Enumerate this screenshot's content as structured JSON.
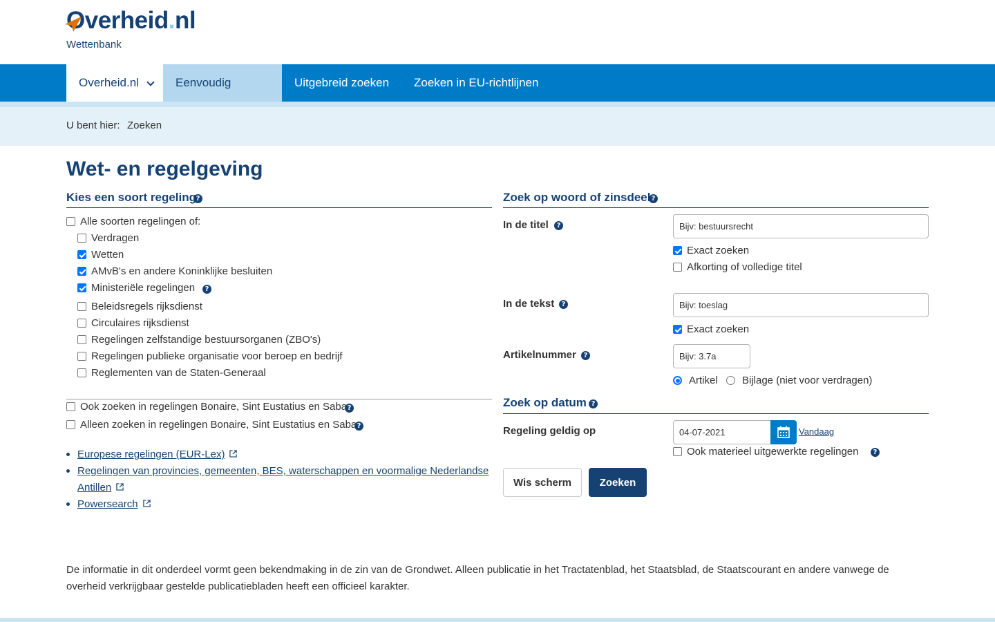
{
  "header": {
    "logo_text": "Overheid",
    "logo_dot": ".",
    "logo_tld": "nl",
    "subtitle": "Wettenbank"
  },
  "nav": {
    "items": [
      "Overheid.nl",
      "Eenvoudig zoeken",
      "Uitgebreid zoeken",
      "Zoeken in EU-richtlijnen"
    ],
    "active": "Eenvoudig zoeken"
  },
  "breadcrumb": {
    "label": "U bent hier:",
    "current": "Zoeken"
  },
  "page_title": "Wet- en regelgeving",
  "left": {
    "section_title": "Kies een soort regeling",
    "all_types": {
      "label": "Alle soorten regelingen of:",
      "checked": false
    },
    "types": [
      {
        "label": "Verdragen",
        "checked": false
      },
      {
        "label": "Wetten",
        "checked": true
      },
      {
        "label": "AMvB's en andere Koninklijke besluiten",
        "checked": true
      },
      {
        "label": "Ministeriële regelingen",
        "checked": true
      },
      {
        "label": "Beleidsregels rijksdienst",
        "checked": false
      },
      {
        "label": "Circulaires rijksdienst",
        "checked": false
      },
      {
        "label": "Regelingen zelfstandige bestuursorganen (ZBO's)",
        "checked": false
      },
      {
        "label": "Regelingen publieke organisatie voor beroep en bedrijf",
        "checked": false
      },
      {
        "label": "Reglementen van de Staten-Generaal",
        "checked": false
      }
    ],
    "bes_also": {
      "label": "Ook zoeken in regelingen Bonaire, Sint Eustatius en Saba",
      "checked": false
    },
    "bes_only": {
      "label": "Alleen zoeken in regelingen Bonaire, Sint Eustatius en Saba",
      "checked": false
    },
    "links": [
      "Europese regelingen (EUR-Lex)",
      "Regelingen van provincies, gemeenten, BES, waterschappen en voormalige Nederlandse",
      "Antillen",
      "Powersearch"
    ]
  },
  "right": {
    "word_section_title": "Zoek op woord of zinsdeel",
    "title_label": "In de titel",
    "title_placeholder": "Bijv: bestuursrecht",
    "title_exact": {
      "label": "Exact zoeken",
      "checked": true
    },
    "title_abbrev": {
      "label": "Afkorting of volledige titel",
      "checked": false
    },
    "text_label": "In de tekst",
    "text_placeholder": "Bijv: toeslag",
    "text_exact": {
      "label": "Exact zoeken",
      "checked": true
    },
    "article_label": "Artikelnummer",
    "article_placeholder": "Bijv: 3.7a",
    "article_radio": [
      {
        "label": "Artikel",
        "checked": true
      },
      {
        "label": "Bijlage (niet voor verdragen)",
        "checked": false
      }
    ],
    "date_section_title": "Zoek op datum",
    "valid_on_label": "Regeling geldig op",
    "date_value": "04-07-2021",
    "today_link": "Vandaag",
    "material": {
      "label": "Ook materieel uitgewerkte regelingen",
      "checked": false
    },
    "clear_button": "Wis scherm",
    "search_button": "Zoeken"
  },
  "disclaimer": "De informatie in dit onderdeel vormt geen bekendmaking in de zin van de Grondwet. Alleen publicatie in het Tractatenblad, het Staatsblad, de Staatscourant en andere vanwege de overheid verkrijgbaar gestelde publicatiebladen heeft een officieel karakter.",
  "colors": {
    "brand_dark": "#154273",
    "nav_blue": "#007bc7",
    "nav_active": "#b2d7ee",
    "breadcrumb_bg": "#e5f1f9",
    "logo_orange": "#e17000"
  },
  "icons": [
    "help-icon",
    "chevron-down-icon",
    "calendar-icon",
    "external-link-icon"
  ]
}
